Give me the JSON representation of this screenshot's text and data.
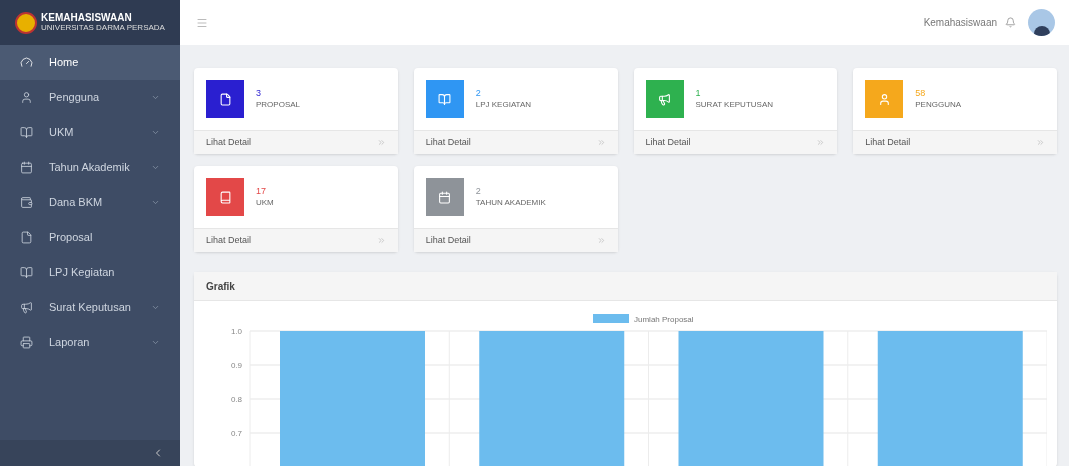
{
  "brand": {
    "title": "KEMAHASISWAAN",
    "subtitle": "UNIVERSITAS DARMA PERSADA"
  },
  "sidebar": {
    "items": [
      {
        "label": "Home",
        "selected": true,
        "kind": "link"
      },
      {
        "label": "Pengguna",
        "selected": false,
        "kind": "dropdown"
      },
      {
        "label": "UKM",
        "selected": false,
        "kind": "dropdown"
      },
      {
        "label": "Tahun Akademik",
        "selected": false,
        "kind": "dropdown"
      },
      {
        "label": "Dana BKM",
        "selected": false,
        "kind": "dropdown"
      },
      {
        "label": "Proposal",
        "selected": false,
        "kind": "link"
      },
      {
        "label": "LPJ Kegiatan",
        "selected": false,
        "kind": "link"
      },
      {
        "label": "Surat Keputusan",
        "selected": false,
        "kind": "dropdown"
      },
      {
        "label": "Laporan",
        "selected": false,
        "kind": "dropdown"
      }
    ]
  },
  "header": {
    "user": "Kemahasiswaan"
  },
  "cards": [
    {
      "count": "3",
      "label": "PROPOSAL",
      "color": "#2a1fd0",
      "link": "Lihat Detail"
    },
    {
      "count": "2",
      "label": "LPJ KEGIATAN",
      "color": "#2f96f3",
      "link": "Lihat Detail"
    },
    {
      "count": "1",
      "label": "SURAT KEPUTUSAN",
      "color": "#2eb14f",
      "link": "Lihat Detail"
    },
    {
      "count": "58",
      "label": "PENGGUNA",
      "color": "#f5a81c",
      "link": "Lihat Detail"
    },
    {
      "count": "17",
      "label": "UKM",
      "color": "#e34848",
      "link": "Lihat Detail"
    },
    {
      "count": "2",
      "label": "TAHUN AKADEMIK",
      "color": "#8e9399",
      "link": "Lihat Detail"
    }
  ],
  "chart": {
    "title": "Grafik",
    "chart_data": {
      "type": "bar",
      "grid": true,
      "series": [
        {
          "name": "Jumlah Proposal",
          "color": "#6cbcee",
          "values": [
            1,
            1,
            1,
            1
          ]
        }
      ],
      "ylim": [
        0.6,
        1.0
      ],
      "yticks": [
        {
          "value": 1.0,
          "label": "1.0"
        },
        {
          "value": 0.9,
          "label": "0.9"
        },
        {
          "value": 0.8,
          "label": "0.8"
        },
        {
          "value": 0.7,
          "label": "0.7"
        }
      ]
    }
  }
}
